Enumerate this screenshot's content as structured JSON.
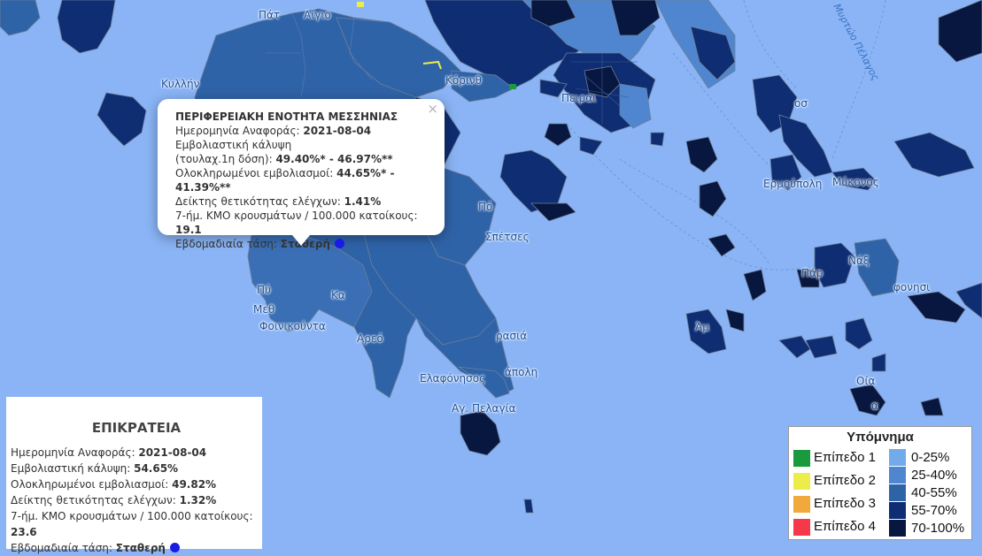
{
  "map": {
    "colors": {
      "sea": "#8ab4f5",
      "band_0_25": "#72aaec",
      "band_25_40": "#4f86cf",
      "band_40_55": "#2f63a8",
      "band_55_70": "#0e2d72",
      "band_70_100": "#07173f",
      "border": "#6d7f99"
    },
    "place_labels": [
      "Πάτ",
      "Αίγιο",
      "Κυλλήν",
      "Κόρινθ",
      "Πειραι",
      "οσ",
      "Ερμούπολη",
      "Μύκονος",
      "Πό",
      "Σπέτσες",
      "Νάξ",
      "Πάρ",
      "φονησι",
      "Πύ",
      "Μεθ",
      "Φοινικούντα",
      "Κα",
      "Αρεό",
      "ρασιά",
      "Ελαφόνησος",
      "άπολη",
      "Αγ. Πελαγία",
      "Οία",
      "Άμ",
      "α"
    ],
    "sea_label": "Μυρτώο Πέλαγος"
  },
  "popup": {
    "title": "ΠΕΡΙΦΕΡΕΙΑΚΗ ΕΝΟΤΗΤΑ ΜΕΣΣΗΝΙΑΣ",
    "date_label": "Ημερομηνία Αναφοράς:",
    "date": "2021-08-04",
    "coverage_label": "Εμβολιαστική κάλυψη",
    "coverage_sub_label": "(τουλαχ.1η δόση):",
    "coverage_value": "49.40%* - 46.97%**",
    "completed_label": "Ολοκληρωμένοι εμβολιασμοί:",
    "completed_value": "44.65%* - 41.39%**",
    "positivity_label": "Δείκτης θετικότητας ελέγχων:",
    "positivity_value": "1.41%",
    "cases_label": "7-ήμ. ΚΜΟ κρουσμάτων / 100.000 κατοίκους:",
    "cases_value": "19.1",
    "trend_label": "Εβδομαδιαία τάση:",
    "trend_value": "Σταθερή",
    "close": "×"
  },
  "country": {
    "title": "ΕΠΙΚΡΑΤΕΙΑ",
    "date_label": "Ημερομηνία Αναφοράς:",
    "date": "2021-08-04",
    "coverage_label": "Εμβολιαστική κάλυψη:",
    "coverage_value": "54.65%",
    "completed_label": "Ολοκληρωμένοι εμβολιασμοί:",
    "completed_value": "49.82%",
    "positivity_label": "Δείκτης θετικότητας ελέγχων:",
    "positivity_value": "1.32%",
    "cases_label": "7-ήμ. ΚΜΟ κρουσμάτων / 100.000 κατοίκους:",
    "cases_value": "23.6",
    "trend_label": "Εβδομαδιαία τάση:",
    "trend_value": "Σταθερή"
  },
  "legend": {
    "title": "Υπόμνημα",
    "levels": [
      {
        "label": "Επίπεδο 1",
        "color": "#1a9a3c"
      },
      {
        "label": "Επίπεδο 2",
        "color": "#ecec4a"
      },
      {
        "label": "Επίπεδο 3",
        "color": "#f0a93a"
      },
      {
        "label": "Επίπεδο 4",
        "color": "#f5394b"
      }
    ],
    "ranges": [
      {
        "label": "0-25%",
        "color": "#72aaec"
      },
      {
        "label": "25-40%",
        "color": "#4f86cf"
      },
      {
        "label": "40-55%",
        "color": "#2f63a8"
      },
      {
        "label": "55-70%",
        "color": "#0e2d72"
      },
      {
        "label": "70-100%",
        "color": "#07173f"
      }
    ]
  }
}
